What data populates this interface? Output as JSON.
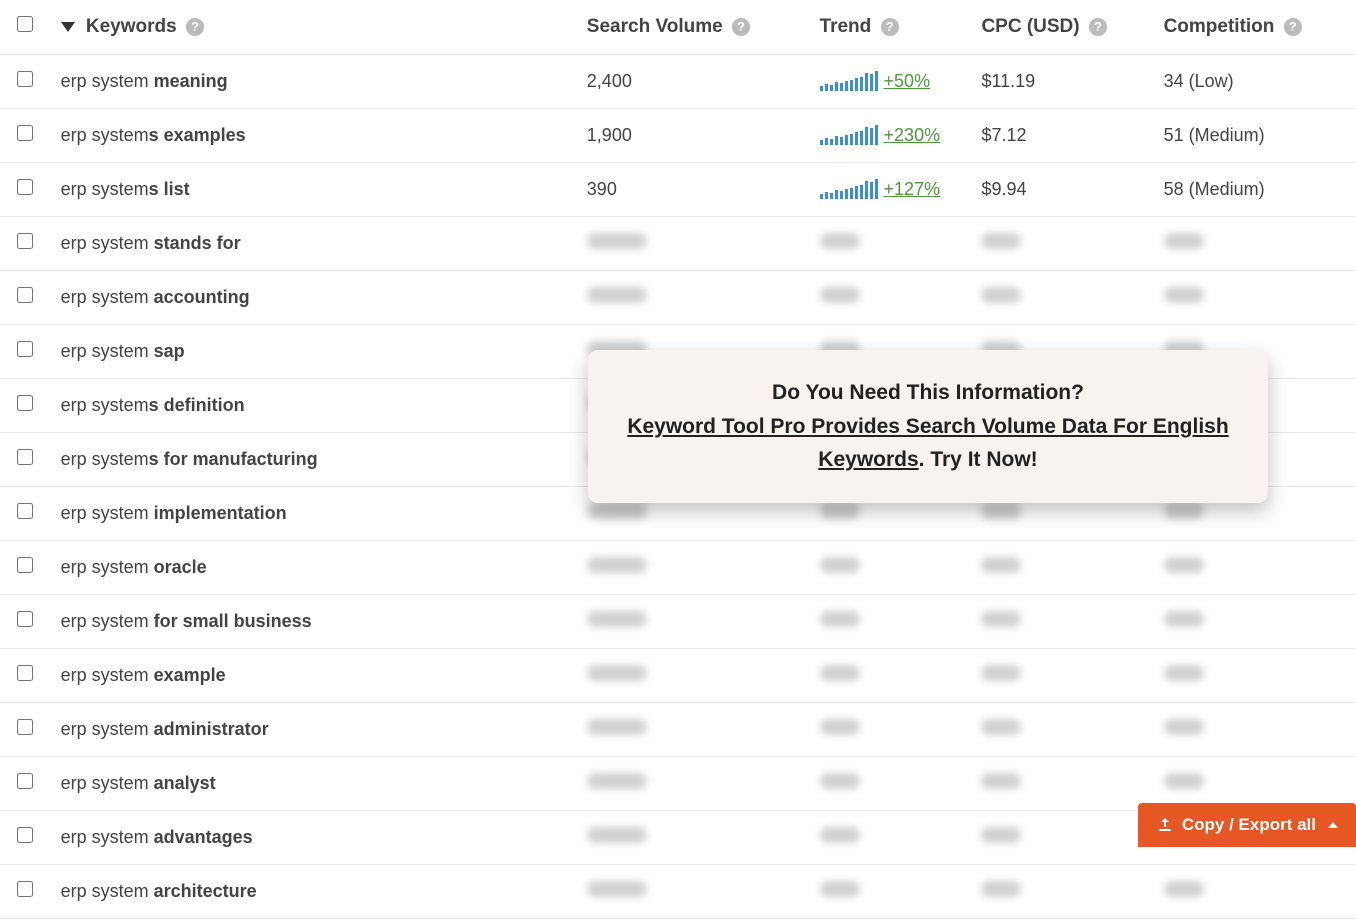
{
  "headers": {
    "keywords": "Keywords",
    "volume": "Search Volume",
    "trend": "Trend",
    "cpc": "CPC (USD)",
    "competition": "Competition"
  },
  "rows": [
    {
      "prefix": "erp system ",
      "suffix": "meaning",
      "volume": "2,400",
      "trend": "+50%",
      "cpc": "$11.19",
      "competition": "34 (Low)",
      "blurred": false
    },
    {
      "prefix": "erp system",
      "suffix": "s examples",
      "volume": "1,900",
      "trend": "+230%",
      "cpc": "$7.12",
      "competition": "51 (Medium)",
      "blurred": false
    },
    {
      "prefix": "erp system",
      "suffix": "s list",
      "volume": "390",
      "trend": "+127%",
      "cpc": "$9.94",
      "competition": "58 (Medium)",
      "blurred": false
    },
    {
      "prefix": "erp system ",
      "suffix": "stands for",
      "blurred": true
    },
    {
      "prefix": "erp system ",
      "suffix": "accounting",
      "blurred": true
    },
    {
      "prefix": "erp system ",
      "suffix": "sap",
      "blurred": true
    },
    {
      "prefix": "erp system",
      "suffix": "s definition",
      "blurred": true
    },
    {
      "prefix": "erp system",
      "suffix": "s for manufacturing",
      "blurred": true
    },
    {
      "prefix": "erp system ",
      "suffix": "implementation",
      "blurred": true
    },
    {
      "prefix": "erp system ",
      "suffix": "oracle",
      "blurred": true
    },
    {
      "prefix": "erp system ",
      "suffix": "for small business",
      "blurred": true
    },
    {
      "prefix": "erp system ",
      "suffix": "example",
      "blurred": true
    },
    {
      "prefix": "erp system ",
      "suffix": "administrator",
      "blurred": true
    },
    {
      "prefix": "erp system ",
      "suffix": "analyst",
      "blurred": true
    },
    {
      "prefix": "erp system ",
      "suffix": "advantages",
      "blurred": true
    },
    {
      "prefix": "erp system ",
      "suffix": "architecture",
      "blurred": true
    }
  ],
  "callout": {
    "line1": "Do You Need This Information?",
    "link": "Keyword Tool Pro Provides Search Volume Data For English Keywords",
    "line2_suffix": ". Try It Now!"
  },
  "export_button": "Copy / Export all",
  "trend_bars": [
    5,
    7,
    6,
    9,
    8,
    10,
    11,
    13,
    14,
    18,
    17,
    20
  ]
}
